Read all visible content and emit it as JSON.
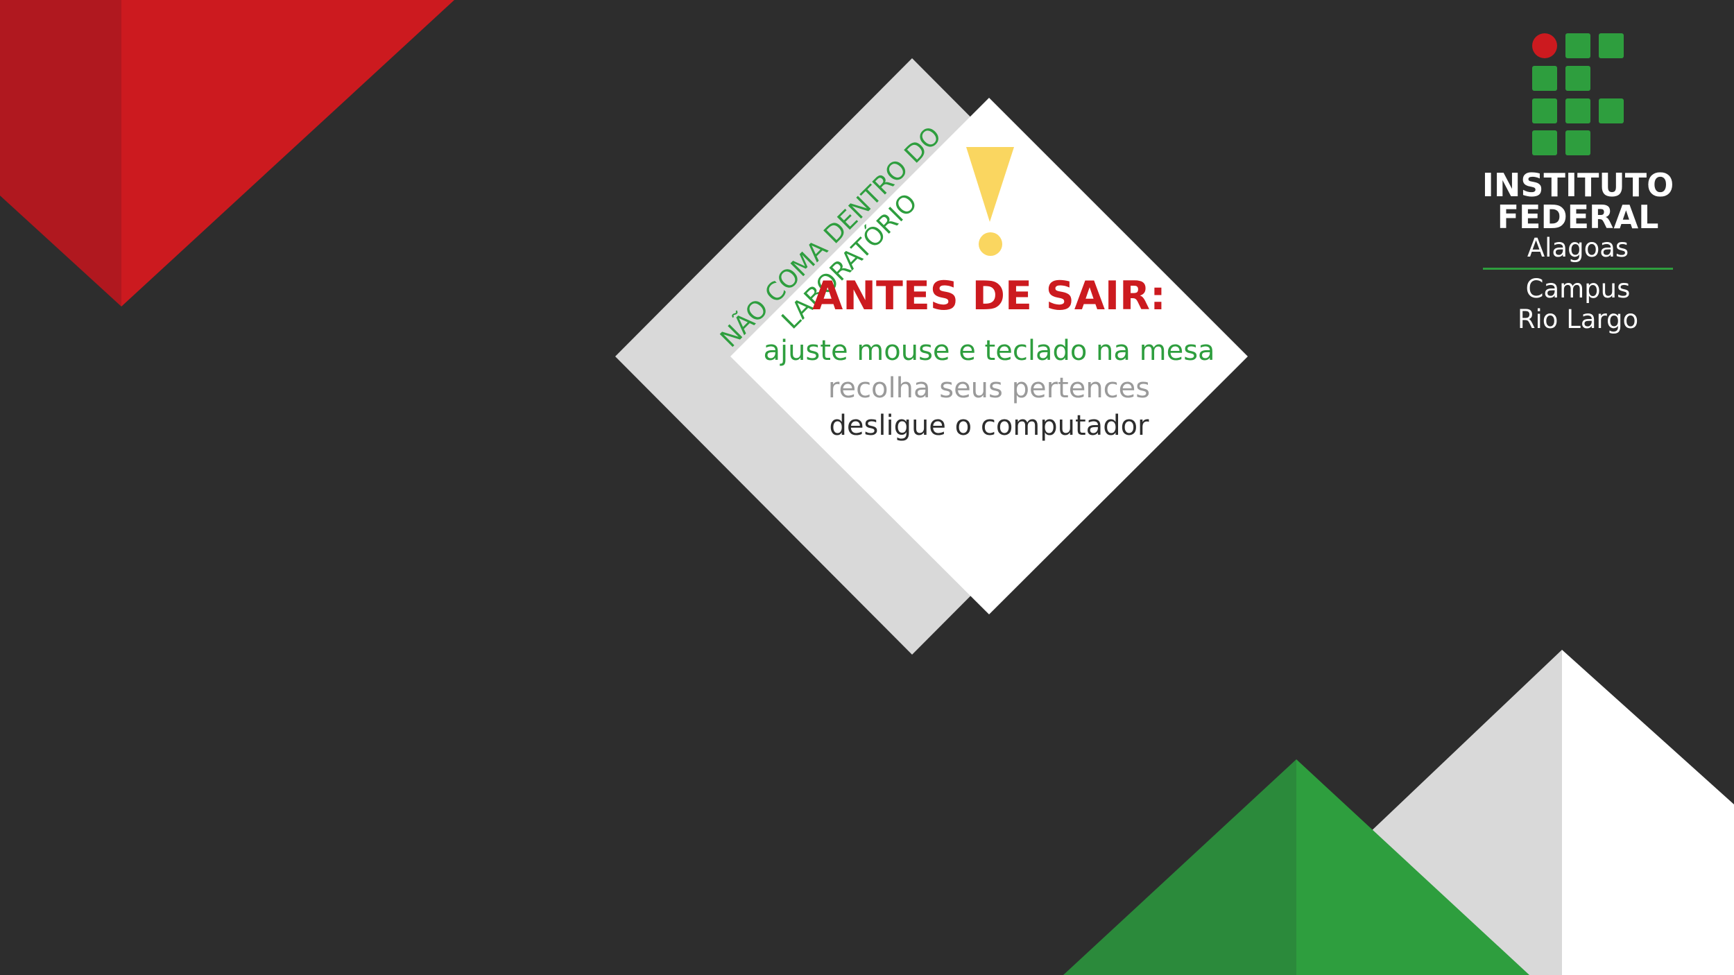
{
  "colors": {
    "background": "#2d2d2d",
    "red": "#cc1a1f",
    "dark_red": "#b0181f",
    "green": "#2e9e3e",
    "dark_green": "#2b8a3b",
    "light_gray": "#d9d9d9",
    "white": "#ffffff",
    "yellow": "#fad660",
    "gray_text": "#9a9a9a",
    "dark_text": "#2d2d2d"
  },
  "notice": {
    "side_note": {
      "line1": "NÃO COMA DENTRO DO",
      "line2": "LABORATÓRIO"
    },
    "icon": "exclamation-icon",
    "heading": "ANTES DE SAIR:",
    "instructions": [
      "ajuste mouse e teclado na mesa",
      "recolha seus pertences",
      "desligue o computador"
    ]
  },
  "logo": {
    "name_line1": "INSTITUTO",
    "name_line2": "FEDERAL",
    "state": "Alagoas",
    "campus_line1": "Campus",
    "campus_line2": "Rio Largo"
  }
}
